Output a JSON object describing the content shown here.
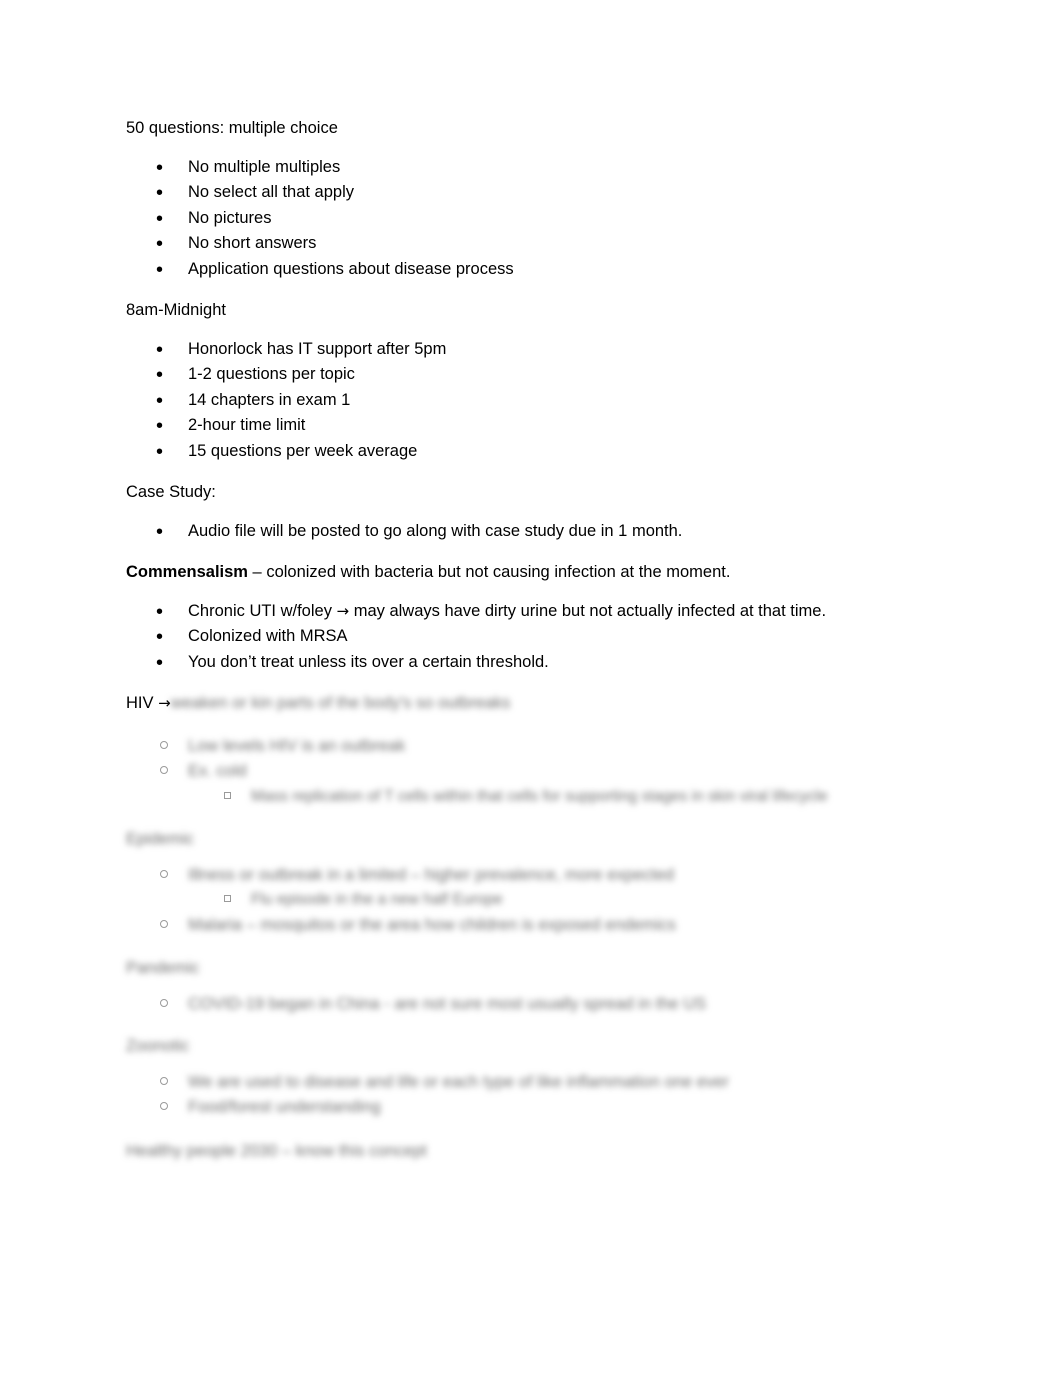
{
  "document": {
    "intro": "50 questions: multiple choice",
    "exam_format_bullets": [
      "No multiple multiples",
      "No select all that apply",
      "No pictures",
      "No short answers",
      "Application questions about disease process"
    ],
    "hours_heading": "8am-Midnight",
    "logistics_bullets": [
      "Honorlock has IT support after 5pm",
      "1-2 questions per topic",
      "14 chapters in exam 1",
      "2-hour time limit",
      "15 questions per week average"
    ],
    "case_study_heading": "Case Study:",
    "case_study_bullets": [
      "Audio file will be posted to go along with case study due in 1 month."
    ],
    "commensalism": {
      "term": "Commensalism",
      "definition": " – colonized with bacteria but not causing infection at the moment."
    },
    "commensalism_bullets": [
      {
        "pre": "Chronic UTI w/foley ",
        "arrow": "→",
        "post": " may always have dirty urine but not actually infected at that time."
      },
      {
        "pre": "Colonized with MRSA",
        "arrow": "",
        "post": ""
      },
      {
        "pre": "You don’t treat unless its over a certain threshold.",
        "arrow": "",
        "post": ""
      }
    ],
    "hiv": {
      "label": "HIV ",
      "arrow": "→",
      "blurred_tail": "weaken or kin parts of the body's so outbreaks"
    },
    "blurred_sections": [
      {
        "heading": "",
        "items": [
          {
            "level": 1,
            "text": "Low levels HIV is an outbreak"
          },
          {
            "level": 1,
            "text": "Ex. cold"
          },
          {
            "level": 2,
            "text": "Mass replication of T cells within that cells for supporting stages in skin viral lifecycle"
          }
        ]
      },
      {
        "heading": "Epidemic",
        "items": [
          {
            "level": 1,
            "text": "Illness or outbreak in a limited –  higher prevalence, more expected"
          },
          {
            "level": 2,
            "text": "Flu episode in the a new half Europe"
          },
          {
            "level": 1,
            "text": "Malaria –   mosquitos or the area how children is exposed endemics"
          }
        ]
      },
      {
        "heading": "Pandemic",
        "items": [
          {
            "level": 1,
            "text": "COVID-19 began in China - are not sure most usually spread in the US"
          }
        ]
      },
      {
        "heading": "Zoonotic",
        "items": [
          {
            "level": 1,
            "text": "We are used to disease and life or each type of like inflammation one ever"
          },
          {
            "level": 1,
            "text": "Food/forest understanding"
          }
        ]
      },
      {
        "heading": "Healthy people 2030 –   know this concept",
        "items": []
      }
    ]
  }
}
